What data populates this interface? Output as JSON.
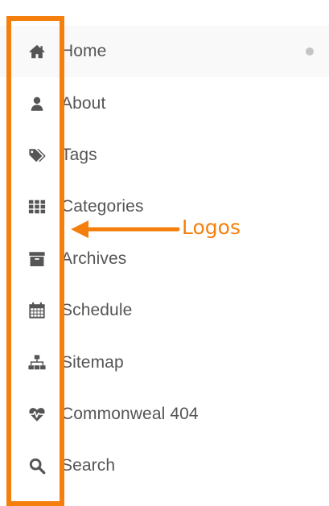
{
  "menu": {
    "items": [
      {
        "label": "Home",
        "icon": "home-icon",
        "active": true
      },
      {
        "label": "About",
        "icon": "user-icon",
        "active": false
      },
      {
        "label": "Tags",
        "icon": "tags-icon",
        "active": false
      },
      {
        "label": "Categories",
        "icon": "grid-icon",
        "active": false
      },
      {
        "label": "Archives",
        "icon": "archive-icon",
        "active": false
      },
      {
        "label": "Schedule",
        "icon": "calendar-icon",
        "active": false
      },
      {
        "label": "Sitemap",
        "icon": "sitemap-icon",
        "active": false
      },
      {
        "label": "Commonweal 404",
        "icon": "heartbeat-icon",
        "active": false
      },
      {
        "label": "Search",
        "icon": "search-icon",
        "active": false
      }
    ]
  },
  "annotation": {
    "label": "Logos",
    "color": "#f57f0c"
  },
  "colors": {
    "text": "#555555",
    "icon": "#555555",
    "active_background": "#f9f9f9",
    "active_dot": "#c4c4c4",
    "accent": "#f57f0c"
  }
}
